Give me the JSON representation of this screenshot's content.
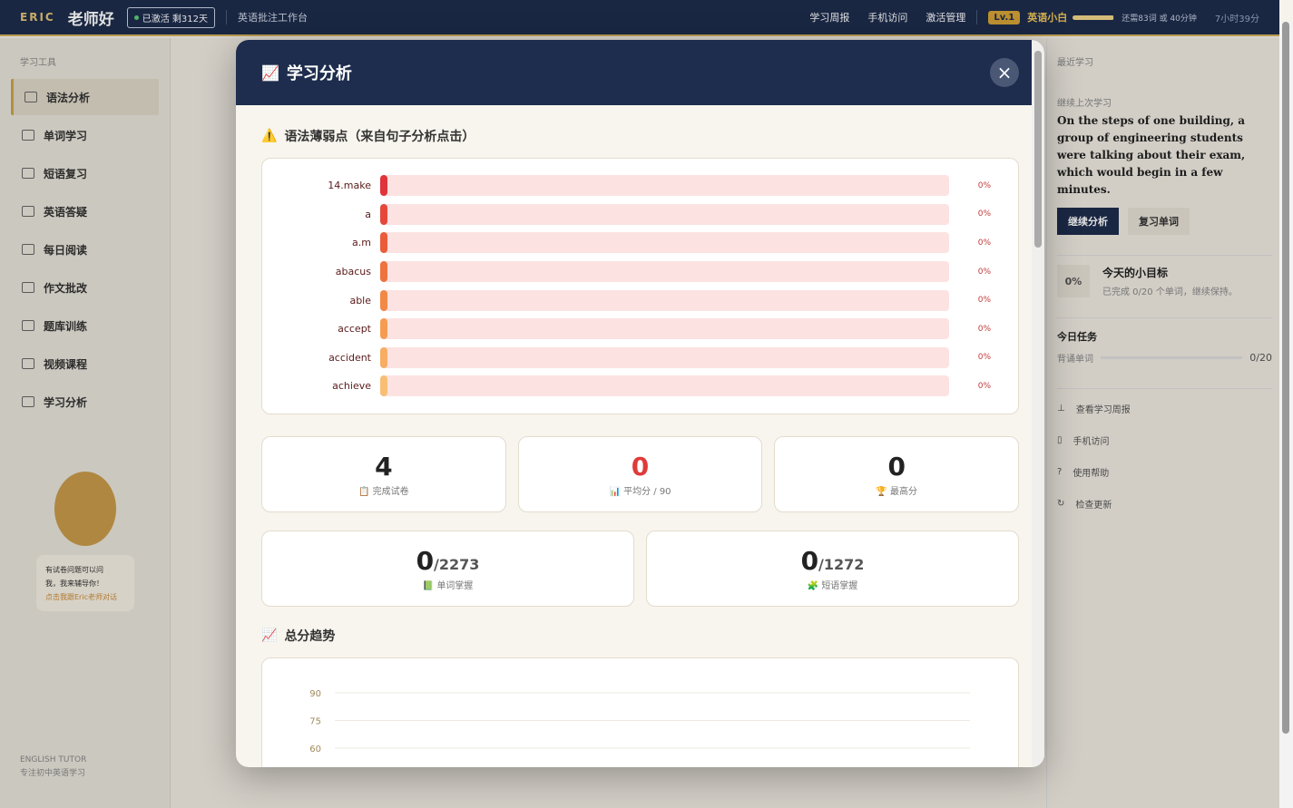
{
  "topbar": {
    "brand": "ERIC",
    "brand_name": "老师好",
    "status": "已激活 剩312天",
    "subtitle": "英语批注工作台",
    "links": [
      "学习周报",
      "手机访问",
      "激活管理"
    ],
    "level_badge": "Lv.1",
    "level_name": "英语小白",
    "xp_progress": 0.98,
    "xp_text": "还需83词 或 40分钟",
    "time_text": "7小时39分"
  },
  "sidebar": {
    "title": "学习工具",
    "items": [
      {
        "label": "语法分析",
        "active": true
      },
      {
        "label": "单词学习",
        "active": false
      },
      {
        "label": "短语复习",
        "active": false
      },
      {
        "label": "英语答疑",
        "active": false
      },
      {
        "label": "每日阅读",
        "active": false
      },
      {
        "label": "作文批改",
        "active": false
      },
      {
        "label": "题库训练",
        "active": false
      },
      {
        "label": "视频课程",
        "active": false
      },
      {
        "label": "学习分析",
        "active": false
      }
    ],
    "bubble_line1": "有试卷问题可以问",
    "bubble_line2": "我，我来辅导你！",
    "bubble_link": "点击我跟Eric老师对话",
    "footer_line1": "ENGLISH TUTOR",
    "footer_line2": "专注初中英语学习"
  },
  "right_panel": {
    "title": "最近学习",
    "continue_label": "继续上次学习",
    "sentence": "On the steps of one building, a group of engineering students were talking about their exam, which would begin in a few minutes.",
    "btn_continue": "继续分析",
    "btn_review": "复习单词",
    "goal_pct": "0%",
    "goal_title": "今天的小目标",
    "goal_desc": "已完成 0/20 个单词，继续保持。",
    "task_title": "今日任务",
    "task_label": "背诵单词",
    "task_count": "0/20",
    "links": [
      "查看学习周报",
      "手机访问",
      "使用帮助",
      "检查更新"
    ]
  },
  "modal": {
    "title": "学习分析",
    "weak_title": "语法薄弱点（来自句子分析点击）",
    "weak_items": [
      {
        "label": "14.make",
        "pct": "0%",
        "color": "#e0333a"
      },
      {
        "label": "a",
        "pct": "0%",
        "color": "#e5483a"
      },
      {
        "label": "a.m",
        "pct": "0%",
        "color": "#ea5c3a"
      },
      {
        "label": "abacus",
        "pct": "0%",
        "color": "#ee733d"
      },
      {
        "label": "able",
        "pct": "0%",
        "color": "#f28845"
      },
      {
        "label": "accept",
        "pct": "0%",
        "color": "#f59c52"
      },
      {
        "label": "accident",
        "pct": "0%",
        "color": "#f7ad62"
      },
      {
        "label": "achieve",
        "pct": "0%",
        "color": "#f8be74"
      }
    ],
    "stats": [
      {
        "value": "4",
        "label": "完成试卷",
        "icon": "📋"
      },
      {
        "value": "0",
        "label": "平均分 / 90",
        "icon": "📊",
        "red": true
      },
      {
        "value": "0",
        "label": "最高分",
        "icon": "🏆"
      }
    ],
    "mastery": [
      {
        "value": "0",
        "total": "/2273",
        "label": "单词掌握",
        "icon": "📗"
      },
      {
        "value": "0",
        "total": "/1272",
        "label": "短语掌握",
        "icon": "🧩"
      }
    ],
    "trend_title": "总分趋势"
  },
  "chart_data": {
    "type": "line",
    "title": "总分趋势",
    "y_ticks": [
      90,
      75,
      60
    ],
    "ylim": [
      0,
      90
    ],
    "series": []
  }
}
